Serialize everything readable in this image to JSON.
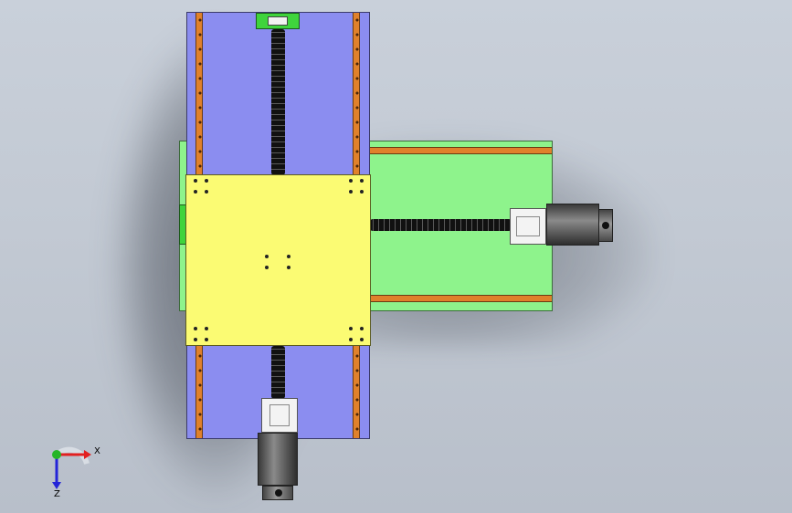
{
  "view": {
    "background": "#c6cdd7",
    "colors": {
      "vertical_base": "#8b8df0",
      "horizontal_base": "#8ef38c",
      "work_table": "#fbfb73",
      "guide_rail": "#e0812b",
      "end_block": "#3fd43c",
      "motor": "#6a6a6a"
    }
  },
  "triad": {
    "x_label": "X",
    "z_label": "Z",
    "x_color": "#e22020",
    "y_color": "#26b526",
    "z_color": "#2424d8"
  }
}
